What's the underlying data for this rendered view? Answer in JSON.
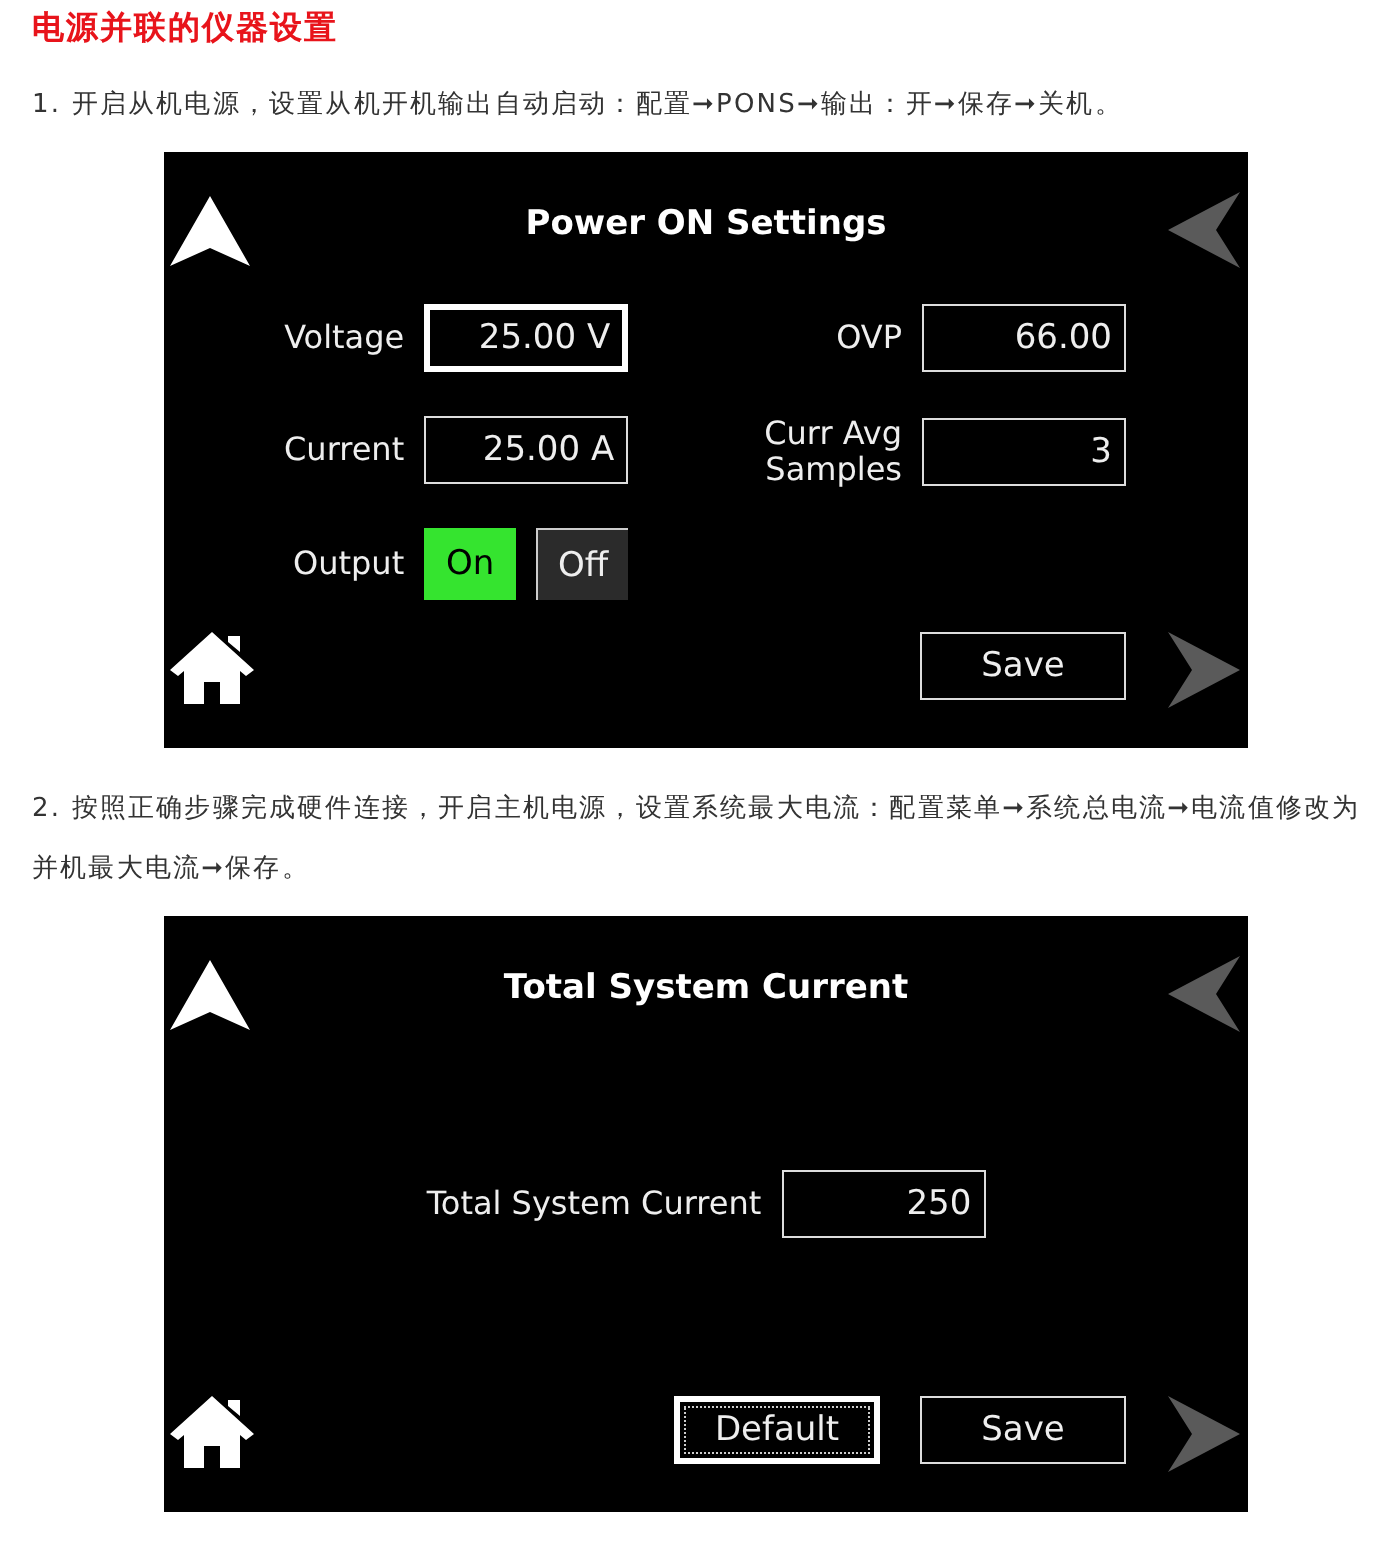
{
  "heading": "电源并联的仪器设置",
  "steps": [
    {
      "text": "1. 开启从机电源，设置从机开机输出自动启动：配置➞PONS➞输出：开➞保存➞关机。",
      "screen": {
        "title": "Power ON Settings",
        "columns": [
          [
            {
              "kind": "field",
              "label": "Voltage",
              "value": "25.00 V",
              "focused": true
            },
            {
              "kind": "field",
              "label": "Current",
              "value": "25.00 A",
              "focused": false
            },
            {
              "kind": "toggle",
              "label": "Output",
              "options": [
                {
                  "label": "On",
                  "selected": true
                },
                {
                  "label": "Off",
                  "selected": false
                }
              ]
            }
          ],
          [
            {
              "kind": "field",
              "label": "OVP",
              "value": "66.00",
              "focused": false
            },
            {
              "kind": "field",
              "label": "Curr Avg Samples",
              "value": "3",
              "focused": false
            }
          ]
        ],
        "buttons": [
          {
            "label": "Save",
            "focused": false
          }
        ]
      }
    },
    {
      "text": "2. 按照正确步骤完成硬件连接，开启主机电源，设置系统最大电流：配置菜单➞系统总电流➞电流值修改为并机最大电流➞保存。",
      "screen": {
        "title": "Total System Current",
        "columns": [
          [
            {
              "kind": "field",
              "label": "Total System Current",
              "value": "250",
              "focused": false
            }
          ]
        ],
        "buttons": [
          {
            "label": "Default",
            "focused": true
          },
          {
            "label": "Save",
            "focused": false
          }
        ]
      }
    }
  ]
}
